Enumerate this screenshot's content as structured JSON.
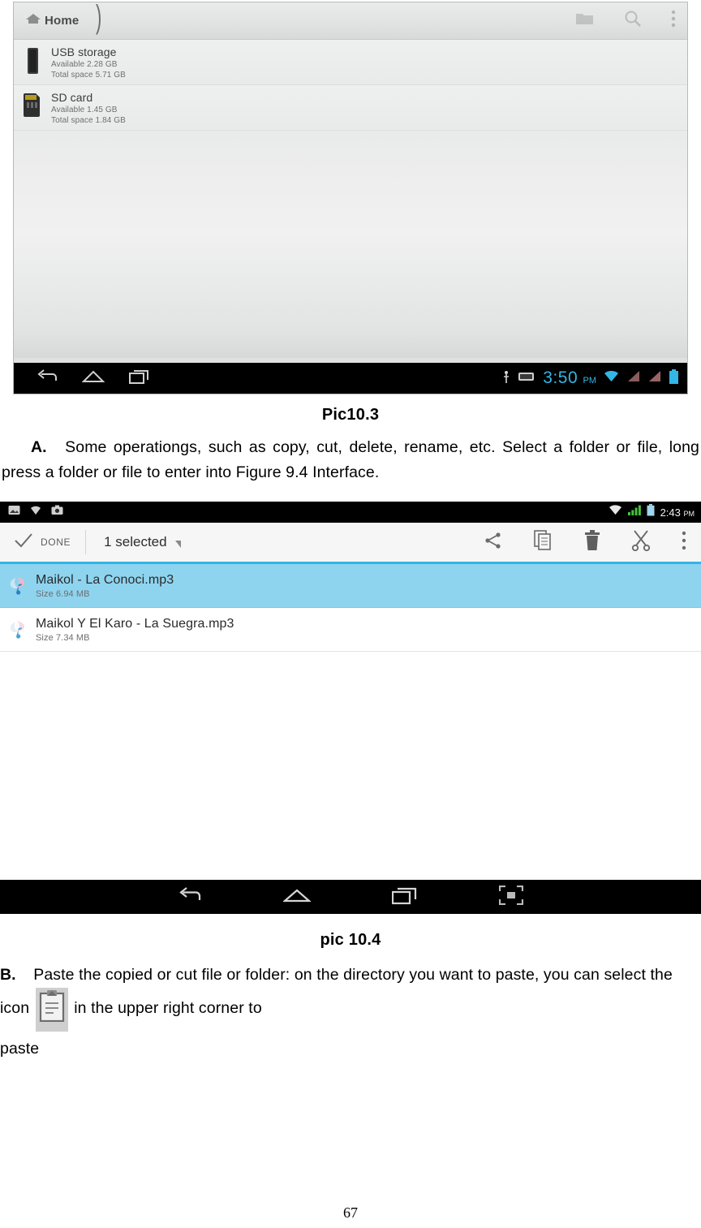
{
  "page": {
    "number": "67"
  },
  "figure1": {
    "caption": "Pic10.3",
    "app": {
      "breadcrumb": "Home",
      "icons": {
        "home": "home-icon",
        "new_folder": "new-folder-icon",
        "search": "search-icon",
        "overflow": "overflow-menu-icon"
      },
      "storage": [
        {
          "title": "USB storage",
          "available": "Available 2.28 GB",
          "total": "Total space 5.71 GB",
          "icon": "usb-storage-icon"
        },
        {
          "title": "SD card",
          "available": "Available 1.45 GB",
          "total": "Total space 1.84 GB",
          "icon": "sd-card-icon"
        }
      ],
      "statusbar": {
        "time": "3:50",
        "ampm": "PM",
        "icons": [
          "usb-icon",
          "battery-charge-icon",
          "wifi-icon",
          "signal-icon",
          "signal-2-icon",
          "battery-icon"
        ]
      },
      "nav": [
        "back-icon",
        "home-nav-icon",
        "recents-icon"
      ]
    }
  },
  "body_a": {
    "lead": "A.",
    "text": "Some operationgs, such as copy, cut, delete, rename, etc. Select a folder or file, long press a folder or file to enter into Figure 9.4 Interface."
  },
  "figure2": {
    "caption": "pic 10.4",
    "app": {
      "statusbar": {
        "time": "2:43",
        "ampm": "PM",
        "left_icons": [
          "screenshot-icon",
          "usb-icon",
          "camera-icon"
        ],
        "right_icons": [
          "wifi-icon",
          "signal-icon",
          "battery-icon"
        ]
      },
      "actionbar": {
        "done_label": "DONE",
        "selection_label": "1 selected",
        "icons": {
          "check": "check-icon",
          "caret": "chevron-down-icon",
          "share": "share-icon",
          "copy": "copy-icon",
          "delete": "delete-trash-icon",
          "cut": "cut-scissors-icon",
          "overflow": "overflow-menu-icon"
        }
      },
      "files": [
        {
          "name": "Maikol - La Conoci.mp3",
          "size": "Size 6.94 MB",
          "selected": true,
          "icon": "music-note-icon"
        },
        {
          "name": "Maikol Y El Karo - La Suegra.mp3",
          "size": "Size 7.34 MB",
          "selected": false,
          "icon": "music-note-icon"
        }
      ],
      "nav": [
        "back-icon",
        "home-nav-icon",
        "recents-icon",
        "screenshot-capture-icon"
      ]
    },
    "colors": {
      "selection_blue": "#8ed4ef",
      "accent_blue": "#33b5e5"
    }
  },
  "body_b": {
    "lead": "B.",
    "text_part1": "Paste the copied or cut file or folder: on the directory you want to paste, you can select the icon",
    "icon": "paste-clipboard-icon",
    "text_part2": "in the upper right corner to",
    "text_part3": "paste"
  }
}
